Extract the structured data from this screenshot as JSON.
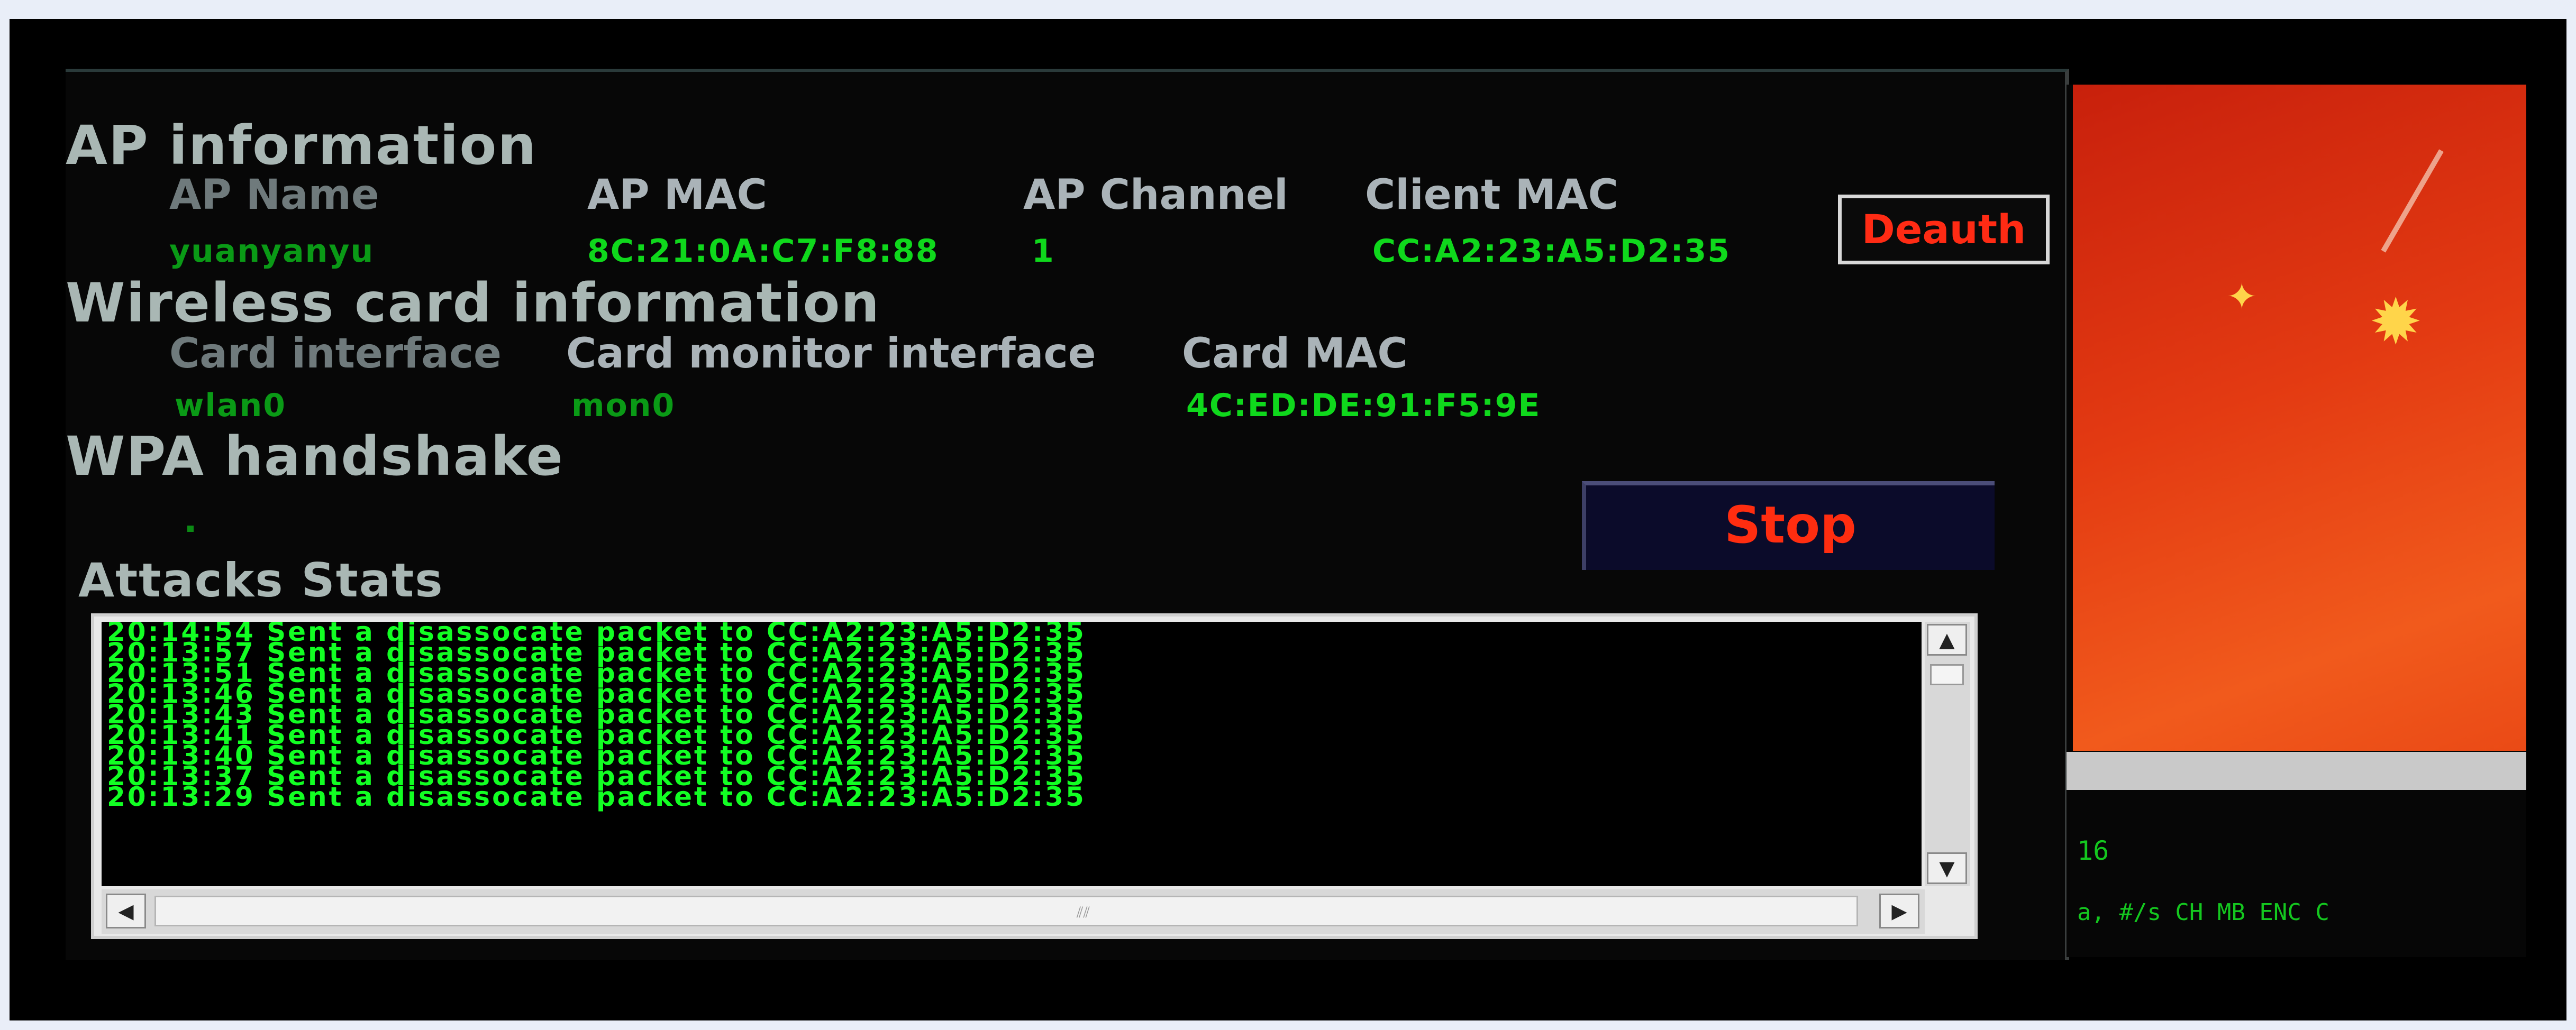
{
  "ap_info": {
    "heading": "AP information",
    "ap_name_label": "AP Name",
    "ap_name_value": "yuanyanyu",
    "ap_mac_label": "AP MAC",
    "ap_mac_value": "8C:21:0A:C7:F8:88",
    "ap_channel_label": "AP Channel",
    "ap_channel_value": "1",
    "client_mac_label": "Client MAC",
    "client_mac_value": "CC:A2:23:A5:D2:35",
    "deauth_label": "Deauth"
  },
  "card_info": {
    "heading": "Wireless card information",
    "interface_label": "Card interface",
    "interface_value": "wlan0",
    "monitor_label": "Card monitor interface",
    "monitor_value": "mon0",
    "mac_label": "Card MAC",
    "mac_value": "4C:ED:DE:91:F5:9E"
  },
  "handshake": {
    "heading": "WPA handshake",
    "stop_label": "Stop"
  },
  "attacks": {
    "heading": "Attacks Stats",
    "log": [
      "20:14:54 Sent a disassocate packet to CC:A2:23:A5:D2:35",
      "20:13:57 Sent a disassocate packet to CC:A2:23:A5:D2:35",
      "20:13:51 Sent a disassocate packet to CC:A2:23:A5:D2:35",
      "20:13:46 Sent a disassocate packet to CC:A2:23:A5:D2:35",
      "20:13:43 Sent a disassocate packet to CC:A2:23:A5:D2:35",
      "20:13:41 Sent a disassocate packet to CC:A2:23:A5:D2:35",
      "20:13:40 Sent a disassocate packet to CC:A2:23:A5:D2:35",
      "20:13:37 Sent a disassocate packet to CC:A2:23:A5:D2:35",
      "20:13:29 Sent a disassocate packet to CC:A2:23:A5:D2:35"
    ]
  },
  "terminal": {
    "line1": "16",
    "line2": "a, #/s  CH  MB   ENC  C"
  },
  "colors": {
    "accent_green": "#0fd81c",
    "alert_red": "#ff2b14",
    "wallpaper": "#e33a12"
  }
}
